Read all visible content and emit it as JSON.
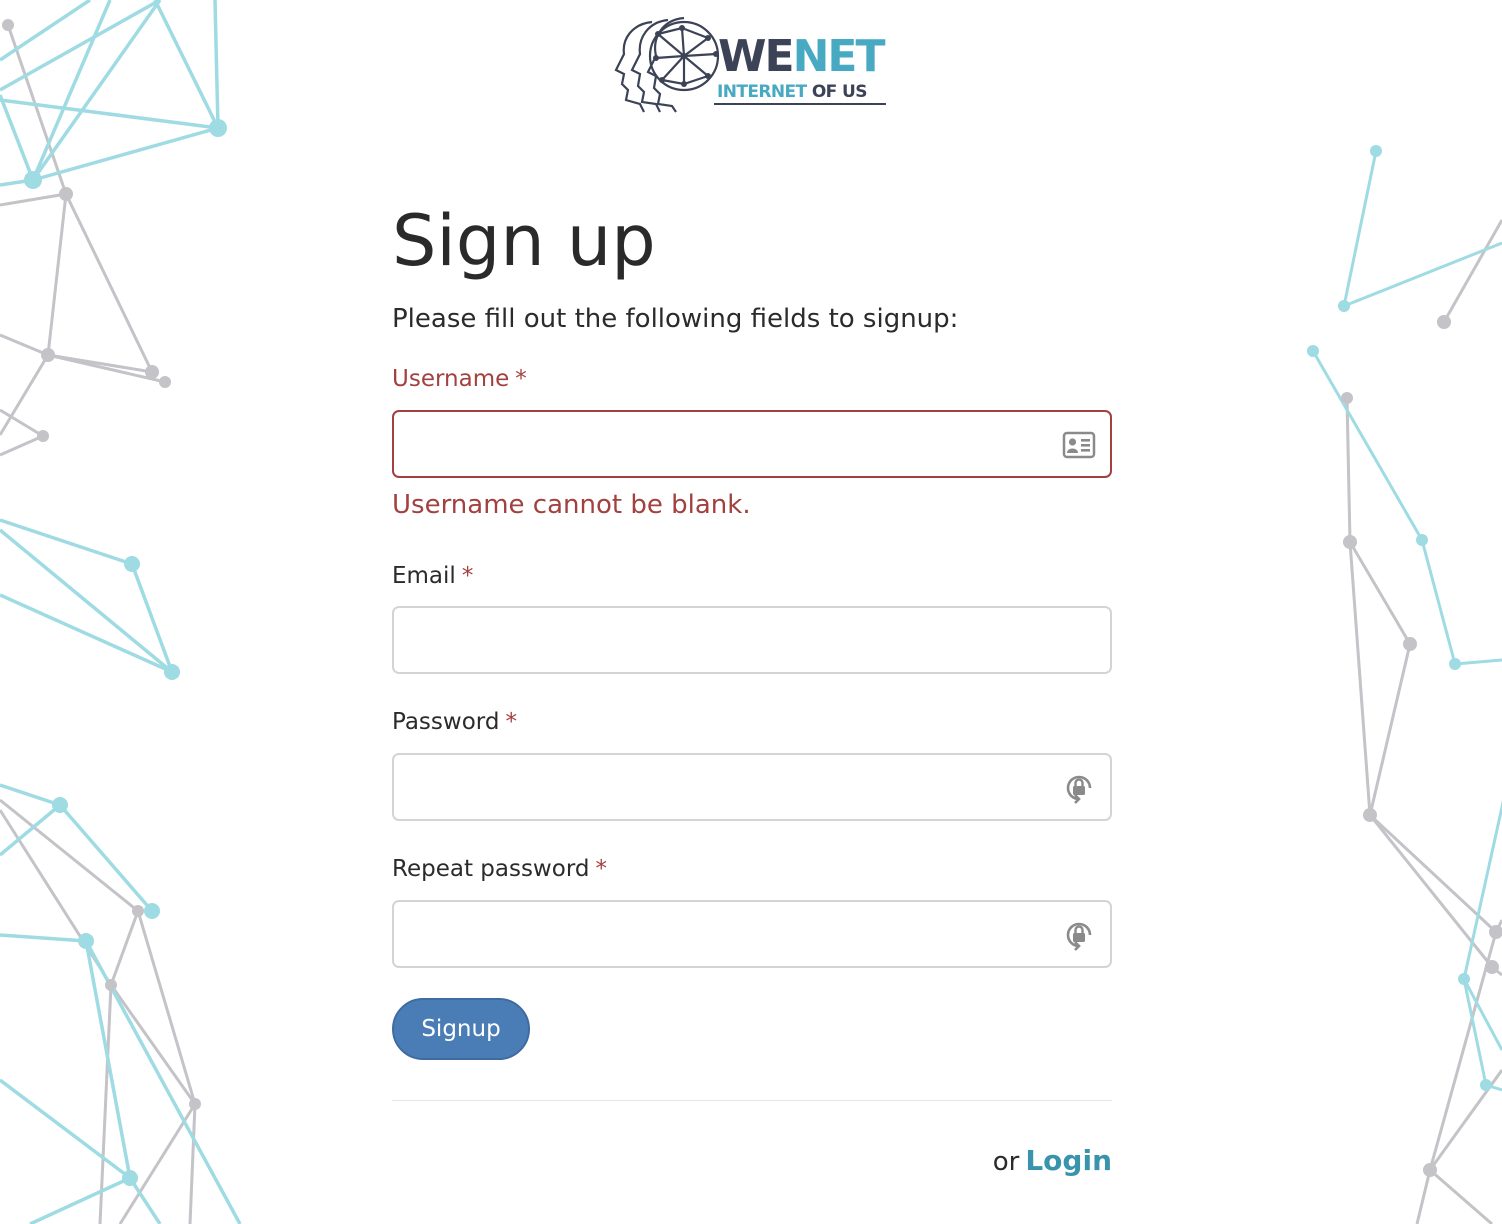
{
  "logo": {
    "name_part1": "WE",
    "name_part2": "NET",
    "tagline_part1": "INTERNET",
    "tagline_part2": " OF US"
  },
  "form": {
    "title": "Sign up",
    "intro": "Please fill out the following fields to signup:",
    "fields": [
      {
        "label": "Username",
        "required_mark": "*",
        "value": "",
        "error": "Username cannot be blank."
      },
      {
        "label": "Email",
        "required_mark": "*",
        "value": ""
      },
      {
        "label": "Password",
        "required_mark": "*",
        "value": ""
      },
      {
        "label": "Repeat password",
        "required_mark": "*",
        "value": ""
      }
    ],
    "submit_label": "Signup"
  },
  "footer": {
    "or_text": "or",
    "login_label": "Login"
  },
  "icons": {
    "username": "id-card-icon",
    "password": "password-lock-icon",
    "repeat_password": "password-lock-icon"
  },
  "colors": {
    "error": "#a2413f",
    "button": "#4a7db6",
    "link": "#3a93ad",
    "decor_teal": "#9fdbe3",
    "decor_gray": "#c3c3c8"
  }
}
